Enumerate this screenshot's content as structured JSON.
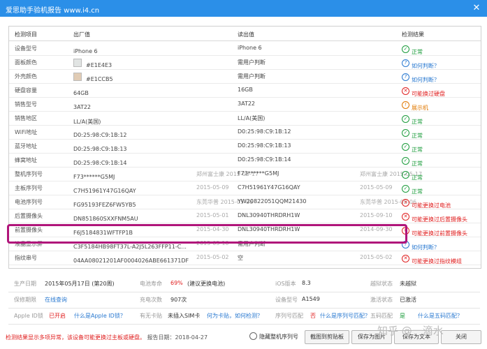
{
  "window": {
    "title": "爱思助手验机报告 www.i4.cn",
    "close": "✕"
  },
  "table": {
    "headers": [
      "检测项目",
      "出厂值",
      "读出值",
      "检测结果"
    ],
    "rows": [
      {
        "item": "设备型号",
        "factory": "iPhone 6",
        "read": "iPhone 6",
        "result": "正常",
        "status": "ok"
      },
      {
        "item": "面板颜色",
        "factory": "#E1E4E3",
        "read": "需用户判断",
        "result": "如何判断？",
        "status": "ask",
        "swatch": "#E1E4E3"
      },
      {
        "item": "外壳颜色",
        "factory": "#E1CCB5",
        "read": "需用户判断",
        "result": "如何判断？",
        "status": "ask",
        "swatch": "#E1CCB5"
      },
      {
        "item": "硬盘容量",
        "factory": "64GB",
        "read": "16GB",
        "result": "可能换过硬盘",
        "status": "bad"
      },
      {
        "item": "销售型号",
        "factory": "3AT22",
        "read": "3AT22",
        "result": "展示机",
        "status": "warn"
      },
      {
        "item": "销售地区",
        "factory": "LL/A(美国)",
        "read": "LL/A(美国)",
        "result": "正常",
        "status": "ok"
      },
      {
        "item": "WiFi地址",
        "factory": "D0:25:98:C9:1B:12",
        "read": "D0:25:98:C9:1B:12",
        "result": "正常",
        "status": "ok"
      },
      {
        "item": "蓝牙地址",
        "factory": "D0:25:98:C9:1B:13",
        "read": "D0:25:98:C9:1B:13",
        "result": "正常",
        "status": "ok"
      },
      {
        "item": "蜂窝地址",
        "factory": "D0:25:98:C9:1B:14",
        "read": "D0:25:98:C9:1B:14",
        "result": "正常",
        "status": "ok"
      },
      {
        "item": "整机序列号",
        "factory": "F73******G5MJ",
        "factory_date": "郑州富士康 2015-05-17",
        "read": "F73******G5MJ",
        "read_date": "郑州富士康 2015-05-17",
        "result": "正常",
        "status": "ok"
      },
      {
        "item": "主板序列号",
        "factory": "C7H51961Y47G16QAY",
        "factory_date": "2015-05-09",
        "read": "C7H51961Y47G16QAY",
        "read_date": "2015-05-09",
        "result": "正常",
        "status": "ok"
      },
      {
        "item": "电池序列号",
        "factory": "FG95193FEZ6FW5YB5",
        "factory_date": "东莞华普 2015-05-06",
        "read": "YW20822051QQM21430",
        "read_date": "东莞华普 2015-05-06",
        "result": "可能更换过电池",
        "status": "bad"
      },
      {
        "item": "后置摄像头",
        "factory": "DN851860SXXFNM5AU",
        "factory_date": "2015-05-01",
        "read": "DNL30940THRDRH1W",
        "read_date": "2015-09-10",
        "result": "可能更换过后置摄像头",
        "status": "bad"
      },
      {
        "item": "前置摄像头",
        "factory": "F6J5184831WFTFP1B",
        "factory_date": "2015-04-30",
        "read": "DNL30940THRDRH1W",
        "read_date": "2014-09-30",
        "result": "可能更换过前置摄像头",
        "status": "bad"
      },
      {
        "item": "液晶显示屏",
        "factory": "C3F5184HB98FT37L-A2J5L263FFP11-C...",
        "factory_date": "2015-05-10",
        "read": "需用户判断",
        "read_date": "",
        "result": "如何判断？",
        "status": "ask"
      },
      {
        "item": "指纹串号",
        "factory": "04AA08021201AF0004026ABE661371DF",
        "factory_date": "2015-05-02",
        "read": "空",
        "read_date": "2015-05-02",
        "result": "可能更换过指纹模组",
        "status": "bad"
      }
    ]
  },
  "summary": {
    "row1": [
      {
        "label": "生产日期",
        "value": "2015年05月17日 (第20周)"
      },
      {
        "label": "电池寿命",
        "value": "69%",
        "value2": "(建议更换电池)"
      },
      {
        "label": "iOS版本",
        "value": "8.3"
      },
      {
        "label": "越狱状态",
        "value": "未越狱"
      }
    ],
    "row2": [
      {
        "label": "保修期限",
        "value": "在线查询"
      },
      {
        "label": "充电次数",
        "value": "907次"
      },
      {
        "label": "设备型号",
        "value": "A1549"
      },
      {
        "label": "激活状态",
        "value": "已激活"
      }
    ],
    "row3": [
      {
        "label": "Apple ID锁",
        "value": "已开启",
        "link": "什么是Apple ID锁？"
      },
      {
        "label": "有无卡贴",
        "value": "未插入SIM卡",
        "link": "何为卡贴，如何检测？"
      },
      {
        "label": "序列号匹配",
        "value": "否",
        "link": "什么是序列号匹配？"
      },
      {
        "label": "五码匹配",
        "value": "是",
        "link": "什么是五码匹配？"
      }
    ]
  },
  "footer": {
    "warning": "检测结果显示多项异常，该设备可能更换过主板或硬盘。",
    "date": "报告日期：2018-04-27",
    "hide_serial": "隐藏整机序列号",
    "btn_clipboard": "截图到剪贴板",
    "btn_image": "保存为图片",
    "btn_text": "保存为文本",
    "btn_close": "关闭"
  },
  "watermark": "知乎 @一滴水",
  "icons": {
    "ok": "✓",
    "ask": "?",
    "bad": "✕",
    "warn": "!"
  },
  "colors": {
    "ok": "#1a9b3a",
    "ask": "#2878d0",
    "bad": "#e02020",
    "warn": "#e07800",
    "accent": "#2b8fe8",
    "highlight": "#b0147a"
  }
}
